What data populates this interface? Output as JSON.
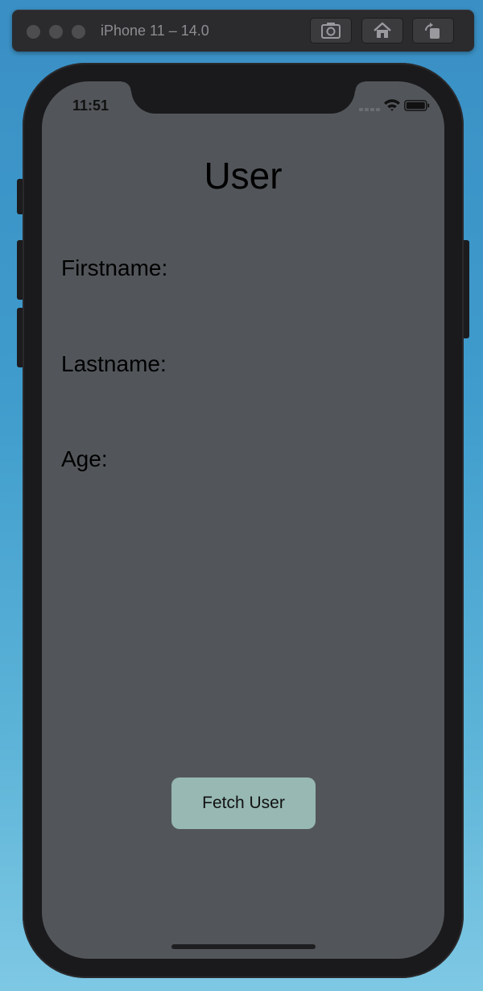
{
  "simulator": {
    "title": "iPhone 11 – 14.0",
    "buttons": [
      "screenshot-icon",
      "home-icon",
      "rotate-icon"
    ]
  },
  "status_bar": {
    "time": "11:51"
  },
  "app": {
    "title": "User",
    "fields": {
      "firstname_label": "Firstname:",
      "lastname_label": "Lastname:",
      "age_label": "Age:"
    },
    "fetch_button_label": "Fetch User"
  },
  "colors": {
    "background_gradient_top": "#3a8fc4",
    "screen_background": "#52565a",
    "button_background": "#97b8b3"
  }
}
